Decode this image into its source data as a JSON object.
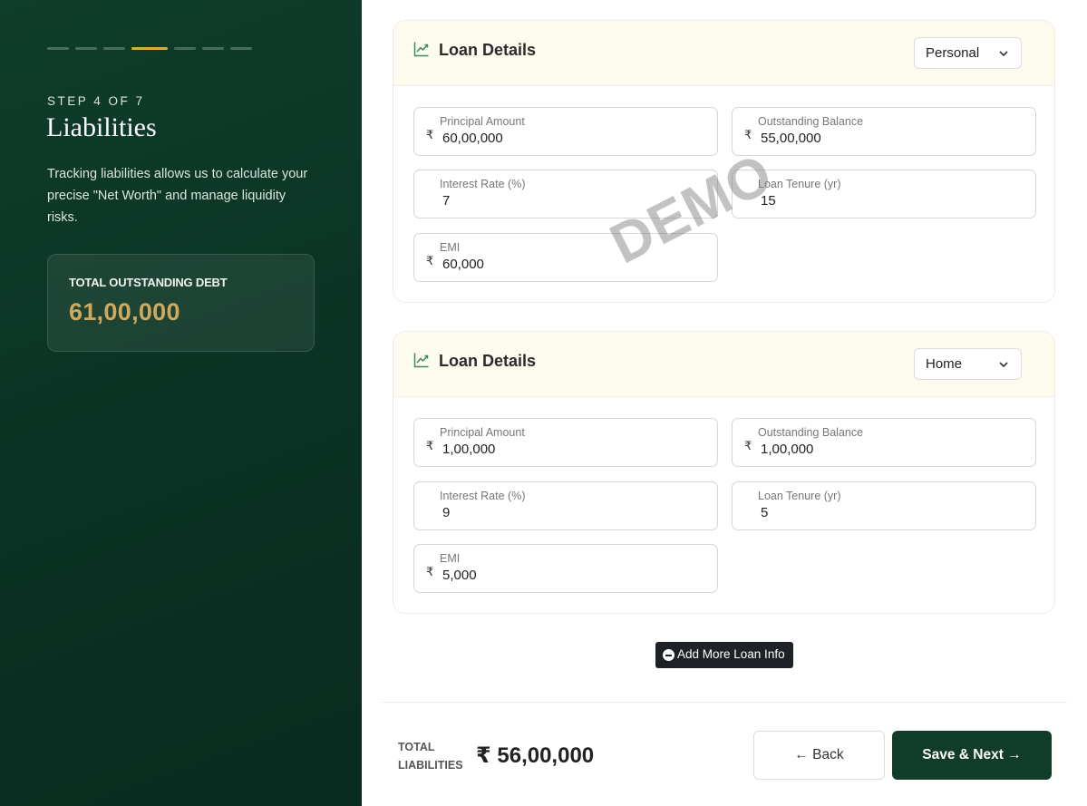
{
  "sidebar": {
    "step_label": "STEP 4 OF 7",
    "title": "Liabilities",
    "description": "Tracking liabilities allows us to calculate your precise \"Net Worth\" and manage liquidity risks.",
    "debt_card": {
      "label": "TOTAL OUTSTANDING DEBT",
      "value": "61,00,000"
    },
    "stepper": {
      "total": 7,
      "current": 4
    }
  },
  "loans": [
    {
      "title": "Loan Details",
      "type": "Personal",
      "fields": {
        "principal": {
          "label": "Principal Amount",
          "currency": "₹",
          "value": "60,00,000"
        },
        "outstanding": {
          "label": "Outstanding Balance",
          "currency": "₹",
          "value": "55,00,000"
        },
        "interest": {
          "label": "Interest Rate (%)",
          "value": "7"
        },
        "tenure": {
          "label": "Loan Tenure (yr)",
          "value": "15"
        },
        "emi": {
          "label": "EMI",
          "currency": "₹",
          "value": "60,000"
        }
      }
    },
    {
      "title": "Loan Details",
      "type": "Home",
      "fields": {
        "principal": {
          "label": "Principal Amount",
          "currency": "₹",
          "value": "1,00,000"
        },
        "outstanding": {
          "label": "Outstanding Balance",
          "currency": "₹",
          "value": "1,00,000"
        },
        "interest": {
          "label": "Interest Rate (%)",
          "value": "9"
        },
        "tenure": {
          "label": "Loan Tenure (yr)",
          "value": "5"
        },
        "emi": {
          "label": "EMI",
          "currency": "₹",
          "value": "5,000"
        }
      }
    }
  ],
  "actions": {
    "add_more_label": "Add More Loan Info",
    "back_label": "← Back",
    "next_label": "Save & Next →"
  },
  "footer": {
    "total_label_line1": "TOTAL",
    "total_label_line2": "LIABILITIES",
    "total_value": "₹ 56,00,000"
  },
  "watermark": "DEMO",
  "colors": {
    "sidebar_bg": "#0f3d2b",
    "accent_gold": "#d4b13c",
    "debt_value": "#d2a95a",
    "primary_button": "#123c2a",
    "card_header": "#fdfbee"
  },
  "icons": {
    "loan_header": "trending-up-icon",
    "dropdown": "chevron-down-icon",
    "add": "minus-circle-icon"
  }
}
